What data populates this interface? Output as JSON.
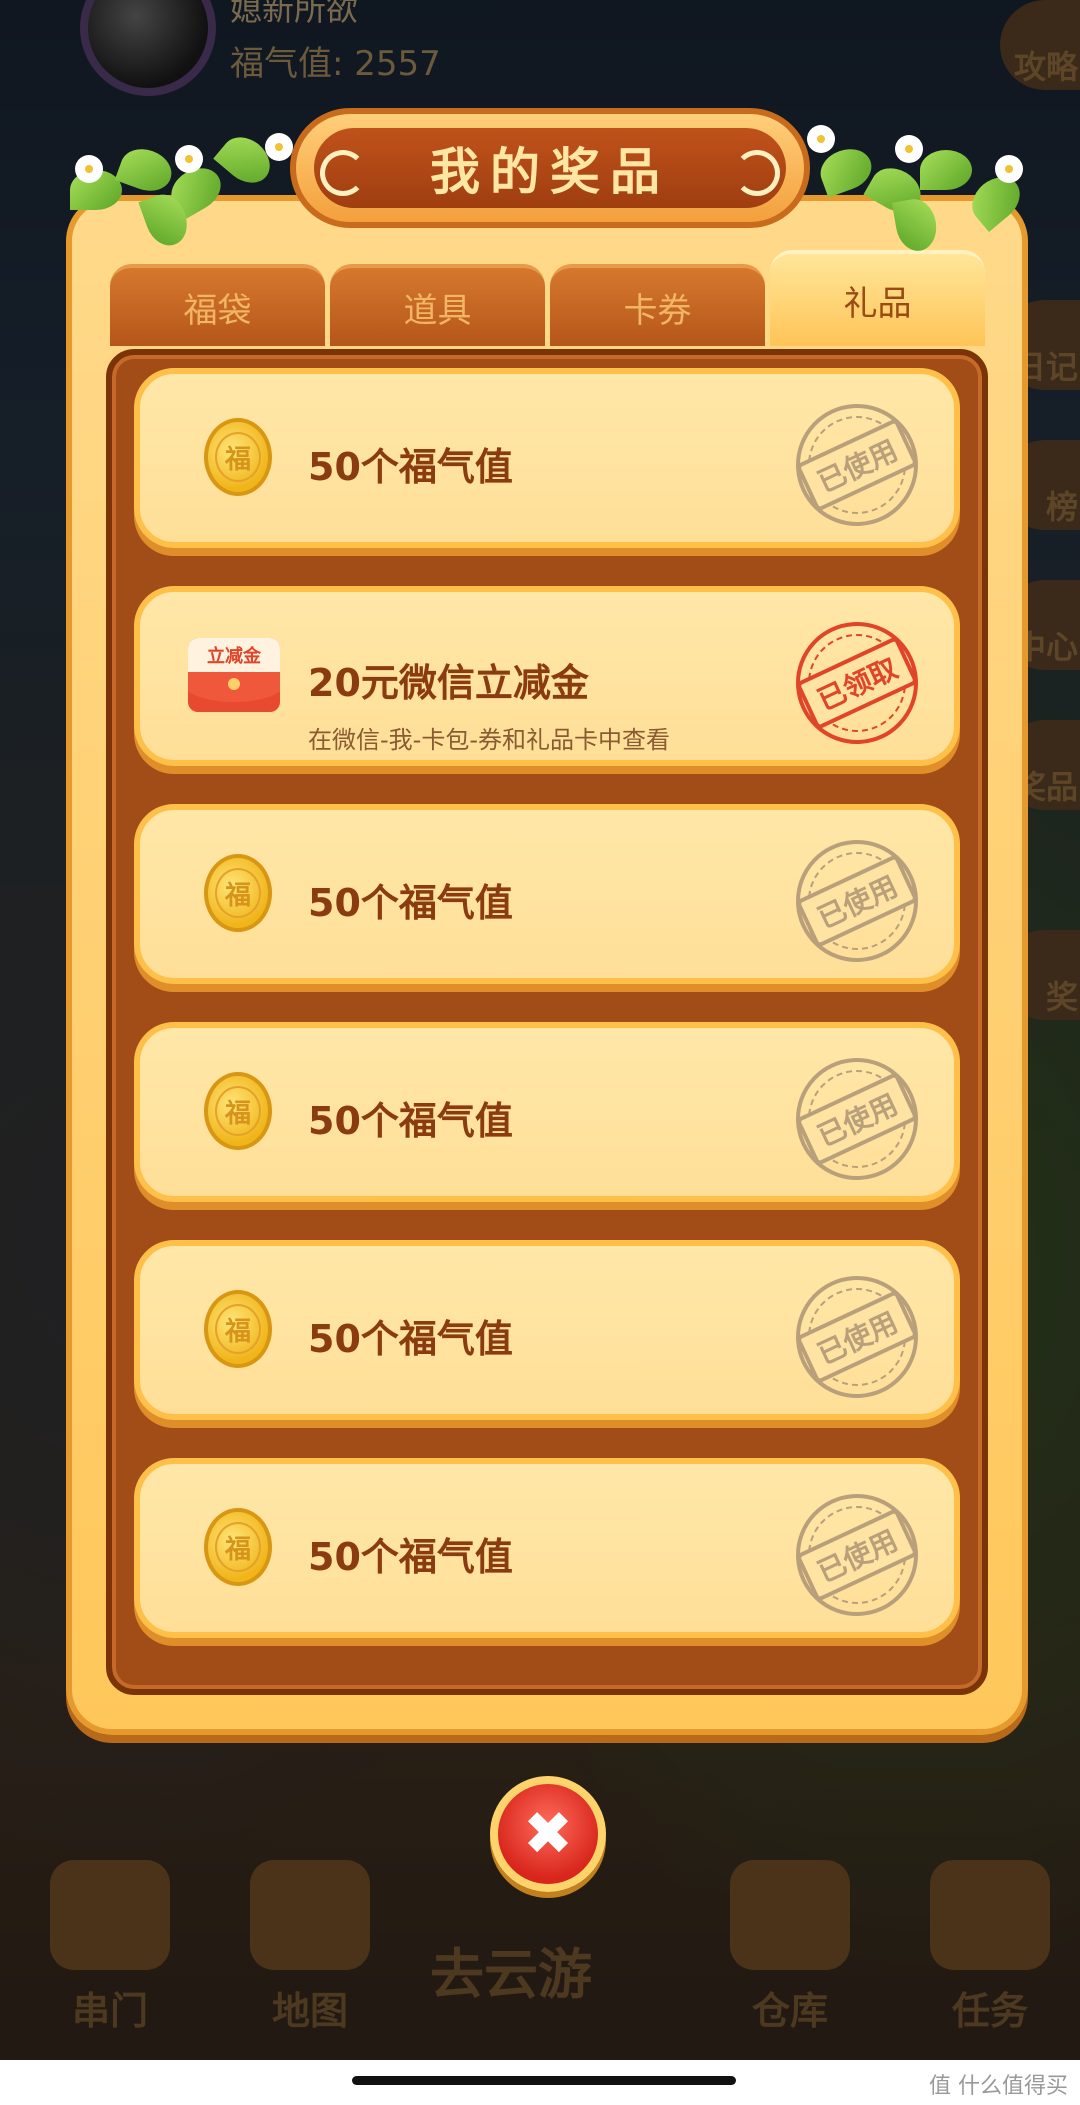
{
  "user": {
    "name": "媳新所欲",
    "fuqi_label": "福气值: 2557"
  },
  "side_buttons": [
    "攻略",
    "",
    "日记",
    "榜",
    "中心",
    "奖品",
    "奖"
  ],
  "modal": {
    "title": "我的奖品",
    "tabs": [
      "福袋",
      "道具",
      "卡券",
      "礼品"
    ],
    "active_tab": "礼品",
    "items": [
      {
        "icon": "coin-icon",
        "coin_char": "福",
        "title": "50个福气值",
        "subtitle": "",
        "status": "已使用"
      },
      {
        "icon": "red-envelope-icon",
        "envelope_label": "立减金",
        "title": "20元微信立减金",
        "subtitle": "在微信-我-卡包-券和礼品卡中查看",
        "status": "已领取"
      },
      {
        "icon": "coin-icon",
        "coin_char": "福",
        "title": "50个福气值",
        "subtitle": "",
        "status": "已使用"
      },
      {
        "icon": "coin-icon",
        "coin_char": "福",
        "title": "50个福气值",
        "subtitle": "",
        "status": "已使用"
      },
      {
        "icon": "coin-icon",
        "coin_char": "福",
        "title": "50个福气值",
        "subtitle": "",
        "status": "已使用"
      },
      {
        "icon": "coin-icon",
        "coin_char": "福",
        "title": "50个福气值",
        "subtitle": "",
        "status": "已使用"
      }
    ],
    "close_symbol": "✖"
  },
  "bottom_nav": {
    "items": [
      "串门",
      "地图",
      "仓库",
      "任务"
    ],
    "center": "去云游"
  },
  "watermark": "值 什么值得买",
  "colors": {
    "stamp_used": "#b9a07a",
    "stamp_claimed": "#e0452a",
    "accent": "#a24c17"
  }
}
